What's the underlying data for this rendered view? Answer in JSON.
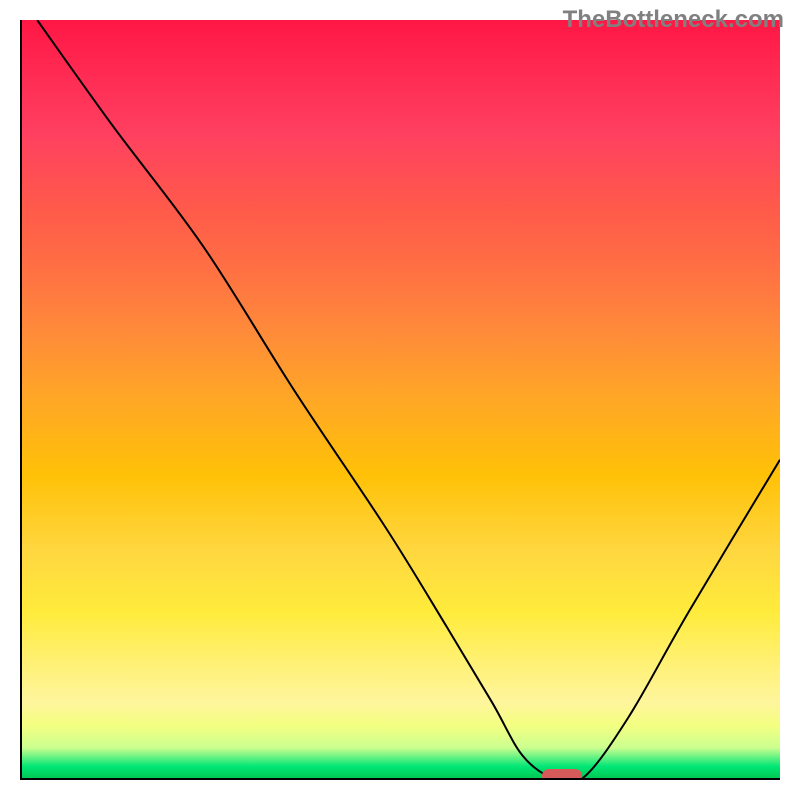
{
  "watermark": "TheBottleneck.com",
  "chart_data": {
    "type": "line",
    "title": "",
    "xlabel": "",
    "ylabel": "",
    "xlim": [
      0,
      100
    ],
    "ylim": [
      0,
      100
    ],
    "grid": false,
    "series": [
      {
        "name": "bottleneck-curve",
        "x": [
          2,
          12,
          24,
          36,
          48,
          56,
          62,
          66,
          70,
          74,
          80,
          88,
          100
        ],
        "y": [
          100,
          86,
          70,
          51,
          33,
          20,
          10,
          3,
          0,
          0,
          8,
          22,
          42
        ]
      }
    ],
    "marker": {
      "x": 71,
      "y": 0.5
    },
    "colors": {
      "curve": "#000000",
      "marker": "#d65a5a",
      "top": "#ff1744",
      "bottom": "#00c853"
    }
  }
}
